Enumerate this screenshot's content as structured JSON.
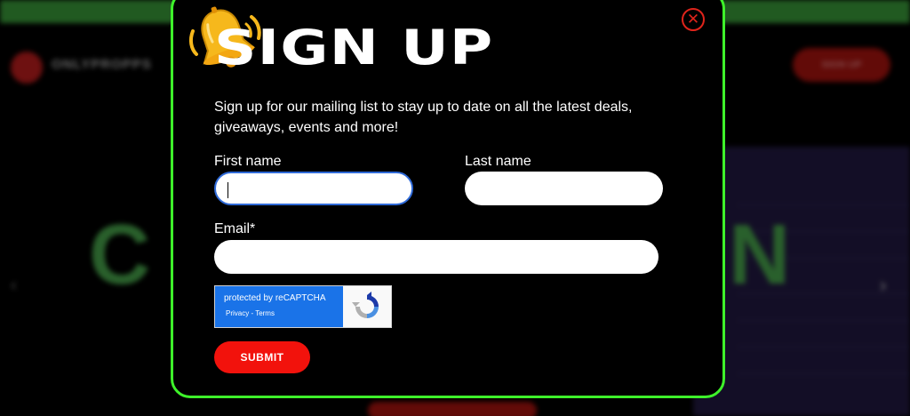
{
  "background": {
    "brand": "ONLYPROPPS",
    "signup_label": "SIGN UP",
    "hero_text_left": "C",
    "hero_text_right": "N"
  },
  "modal": {
    "title": "SIGN UP",
    "description": "Sign up for our mailing list to stay up to date on all the latest deals, giveaways, events and more!",
    "first_name_label": "First name",
    "first_name_value": "",
    "last_name_label": "Last name",
    "last_name_value": "",
    "email_label": "Email*",
    "email_value": "",
    "recaptcha_text": "protected by reCAPTCHA",
    "recaptcha_links": "Privacy - Terms",
    "submit_label": "SUBMIT",
    "close_icon": "close-icon",
    "bell_icon": "bell-icon"
  },
  "colors": {
    "modal_border": "#3ef22a",
    "accent_red": "#f2120c",
    "recaptcha_blue": "#1a73e8"
  }
}
